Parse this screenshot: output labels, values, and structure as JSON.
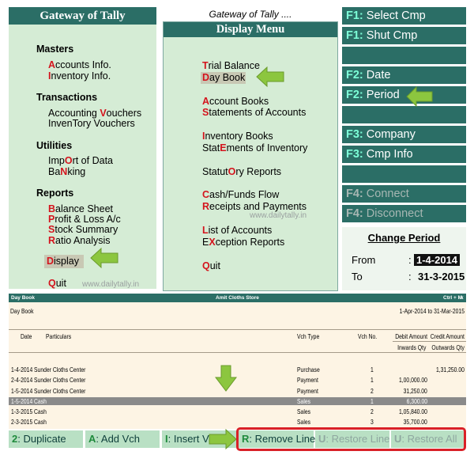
{
  "gateway": {
    "title": "Gateway of Tally",
    "masters_heading": "Masters",
    "masters_items": [
      {
        "pre": "",
        "key": "A",
        "post": "ccounts Info."
      },
      {
        "pre": "",
        "key": "I",
        "post": "nventory Info."
      }
    ],
    "transactions_heading": "Transactions",
    "transactions_items": [
      {
        "pre": "Accounting ",
        "key": "V",
        "post": "ouchers"
      },
      {
        "pre": "InvenTory Vouchers",
        "key": "",
        "post": ""
      }
    ],
    "utilities_heading": "Utilities",
    "utilities_items": [
      {
        "pre": "Imp",
        "key": "O",
        "post": "rt of Data"
      },
      {
        "pre": "Ba",
        "key": "N",
        "post": "king"
      }
    ],
    "reports_heading": "Reports",
    "reports_items": [
      {
        "pre": "",
        "key": "B",
        "post": "alance Sheet"
      },
      {
        "pre": "",
        "key": "P",
        "post": "rofit & Loss A/c"
      },
      {
        "pre": "",
        "key": "S",
        "post": "tock Summary"
      },
      {
        "pre": "",
        "key": "R",
        "post": "atio Analysis"
      }
    ],
    "display": {
      "key": "D",
      "rest": "isplay"
    },
    "quit": {
      "key": "Q",
      "rest": "uit"
    }
  },
  "display_menu": {
    "header": "Gateway of Tally ....",
    "title": "Display Menu",
    "items": [
      {
        "pre": "",
        "key": "T",
        "post": "rial Balance"
      },
      {
        "pre": "",
        "key": "D",
        "post": "ay Book"
      },
      {
        "pre": "",
        "key": "A",
        "post": "ccount Books"
      },
      {
        "pre": "",
        "key": "S",
        "post": "tatements of Accounts"
      },
      {
        "pre": "",
        "key": "I",
        "post": "nventory Books"
      },
      {
        "pre": "Stat",
        "key": "E",
        "post": "ments of Inventory"
      },
      {
        "pre": "Statut",
        "key": "O",
        "post": "ry Reports"
      },
      {
        "pre": "",
        "key": "C",
        "post": "ash/Funds Flow"
      },
      {
        "pre": "",
        "key": "R",
        "post": "eceipts and Payments"
      },
      {
        "pre": "",
        "key": "L",
        "post": "ist of Accounts"
      },
      {
        "pre": "E",
        "key": "X",
        "post": "ception Reports"
      },
      {
        "pre": "",
        "key": "Q",
        "post": "uit"
      }
    ]
  },
  "right_buttons": [
    {
      "key": "F1",
      "label": "Select Cmp",
      "disabled": false
    },
    {
      "key": "F1",
      "label": "Shut Cmp",
      "disabled": false
    },
    {
      "key": "F2",
      "label": "Date",
      "disabled": false
    },
    {
      "key": "F2",
      "label": "Period",
      "disabled": false
    },
    {
      "key": "F3",
      "label": "Company",
      "disabled": false
    },
    {
      "key": "F3",
      "label": "Cmp Info",
      "disabled": false
    },
    {
      "key": "F4",
      "label": "Connect",
      "disabled": true
    },
    {
      "key": "F4",
      "label": "Disconnect",
      "disabled": true
    }
  ],
  "change_period": {
    "title": "Change Period",
    "from_label": "From",
    "from_value": "1-4-2014",
    "to_label": "To",
    "to_value": "31-3-2015",
    "colon": ":"
  },
  "daybook": {
    "bar_left": "Day Book",
    "bar_center": "Amit Cloths Store",
    "bar_right": "Ctrl + M",
    "bar_close": "x",
    "title": "Day Book",
    "period": "1-Apr-2014 to 31-Mar-2015",
    "columns": {
      "date": "Date",
      "particulars": "Particulars",
      "vch_type": "Vch Type",
      "vch_no": "Vch No.",
      "debit": "Debit Amount",
      "debit_sub": "Inwards Qty",
      "credit": "Credit Amount",
      "credit_sub": "Outwards Qty"
    },
    "rows": [
      {
        "date": "1-4-2014",
        "particulars": "Sunder Cloths Center",
        "vch_type": "Purchase",
        "vch_no": "1",
        "debit": "",
        "credit": "1,31,250.00"
      },
      {
        "date": "2-4-2014",
        "particulars": "Sunder Cloths Center",
        "vch_type": "Payment",
        "vch_no": "1",
        "debit": "1,00,000.00",
        "credit": ""
      },
      {
        "date": "1-5-2014",
        "particulars": "Sunder Cloths Center",
        "vch_type": "Payment",
        "vch_no": "2",
        "debit": "31,250.00",
        "credit": ""
      },
      {
        "date": "1-5-2014",
        "particulars": "Cash",
        "vch_type": "Sales",
        "vch_no": "1",
        "debit": "6,300.00",
        "credit": ""
      },
      {
        "date": "1-3-2015",
        "particulars": "Cash",
        "vch_type": "Sales",
        "vch_no": "2",
        "debit": "1,05,840.00",
        "credit": ""
      },
      {
        "date": "2-3-2015",
        "particulars": "Cash",
        "vch_type": "Sales",
        "vch_no": "3",
        "debit": "35,700.00",
        "credit": ""
      }
    ]
  },
  "bottom_buttons": [
    {
      "key": "2",
      "label": ": Duplicate",
      "disabled": false
    },
    {
      "key": "A",
      "label": ": Add Vch",
      "disabled": false
    },
    {
      "key": "I",
      "label": ": Insert Vch",
      "disabled": false
    },
    {
      "key": "R",
      "label": ": Remove Line",
      "disabled": false
    },
    {
      "key": "U",
      "label": ": Restore Line",
      "disabled": true
    },
    {
      "key": "U",
      "label": ": Restore All",
      "disabled": true
    }
  ],
  "watermark": "www.dailytally.in",
  "colors": {
    "panel_green": "#d5ecd5",
    "title_teal": "#2b6e66",
    "hotkey_red": "#d4141d",
    "arrow_green": "#8cc63f",
    "highlight_box": "#d92128"
  }
}
